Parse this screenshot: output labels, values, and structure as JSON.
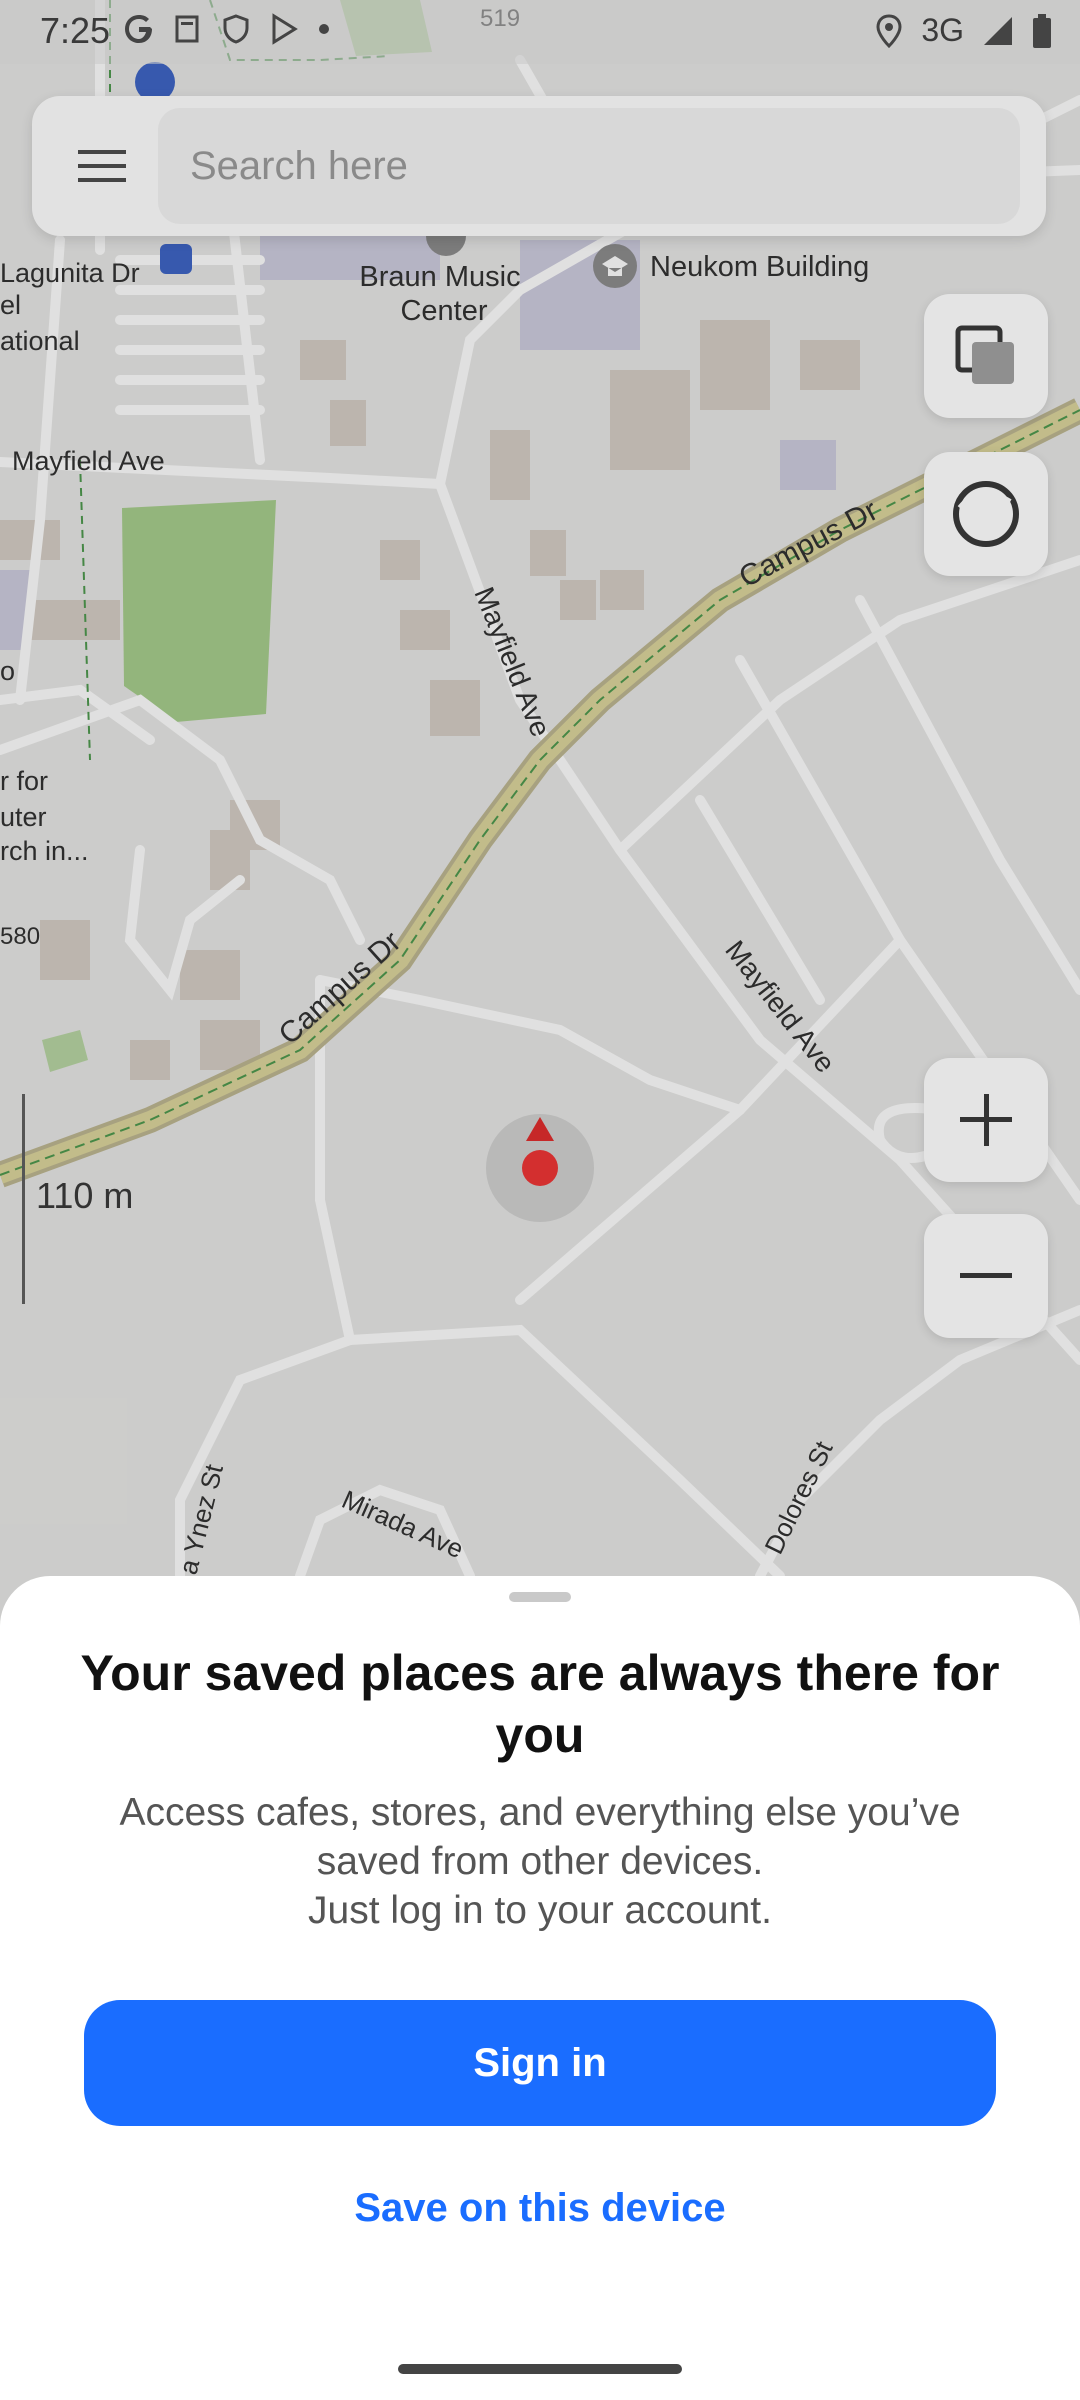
{
  "status_bar": {
    "time": "7:25",
    "network": "3G"
  },
  "search": {
    "placeholder": "Search here"
  },
  "map": {
    "labels": {
      "braun_music_center_1": "Braun Music",
      "braun_music_center_2": "Center",
      "neukom_building": "Neukom Building",
      "lagunita_dr": "Lagunita Dr",
      "national": "ational",
      "el": "el",
      "mayfield_ave_west": "Mayfield Ave",
      "mayfield_ave_vertical": "Mayfield Ave",
      "mayfield_ave_southeast": "Mayfield Ave",
      "campus_dr_northeast": "Campus Dr",
      "campus_dr_southwest": "Campus Dr",
      "for_text": "r for",
      "uter_text": "uter",
      "rch_text": "rch in...",
      "o_text": "o",
      "num_580": "580",
      "num_519": "519",
      "mirada_ave": "Mirada Ave",
      "ynez_st": "a Ynez St",
      "dolores_st": "Dolores St"
    },
    "scale": "110 m"
  },
  "sheet": {
    "title": "Your saved places are always there for you",
    "description_line1": "Access cafes, stores, and everything else you’ve",
    "description_line2": "saved from other devices.",
    "description_line3": "Just log in to your account.",
    "sign_in_label": "Sign in",
    "save_device_label": "Save on this device"
  },
  "colors": {
    "accent": "#1a6dff",
    "location_marker": "#d32f2f",
    "road_major": "#d9d29a",
    "park": "#a8cf8e"
  }
}
